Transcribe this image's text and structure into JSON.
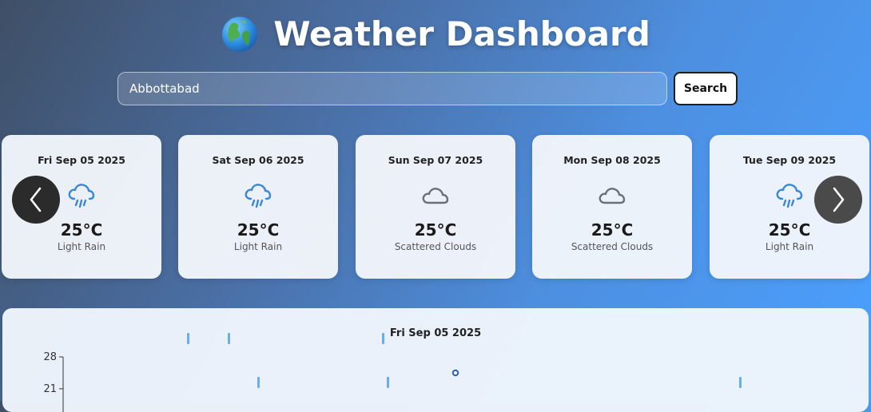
{
  "header": {
    "title": "Weather Dashboard",
    "logo_icon": "globe-icon"
  },
  "search": {
    "value": "Abbottabad",
    "button_label": "Search"
  },
  "forecast": [
    {
      "date": "Fri Sep 05 2025",
      "temp": "25°C",
      "desc": "Light Rain",
      "icon": "rain-icon"
    },
    {
      "date": "Sat Sep 06 2025",
      "temp": "25°C",
      "desc": "Light Rain",
      "icon": "rain-icon"
    },
    {
      "date": "Sun Sep 07 2025",
      "temp": "25°C",
      "desc": "Scattered Clouds",
      "icon": "cloud-icon"
    },
    {
      "date": "Mon Sep 08 2025",
      "temp": "25°C",
      "desc": "Scattered Clouds",
      "icon": "cloud-icon"
    },
    {
      "date": "Tue Sep 09 2025",
      "temp": "25°C",
      "desc": "Light Rain",
      "icon": "rain-icon"
    }
  ],
  "carousel": {
    "prev_icon": "chevron-left-icon",
    "next_icon": "chevron-right-icon"
  },
  "colors": {
    "icon_blue": "#3a86d8",
    "cloud_gray": "#6b6f78",
    "marker_blue": "#6aaee8",
    "point_blue": "#2d5fb3"
  },
  "chart_data": {
    "type": "scatter",
    "title": "Fri Sep 05 2025",
    "yticks": [
      28,
      21
    ],
    "ylim": [
      14,
      28
    ]
  }
}
